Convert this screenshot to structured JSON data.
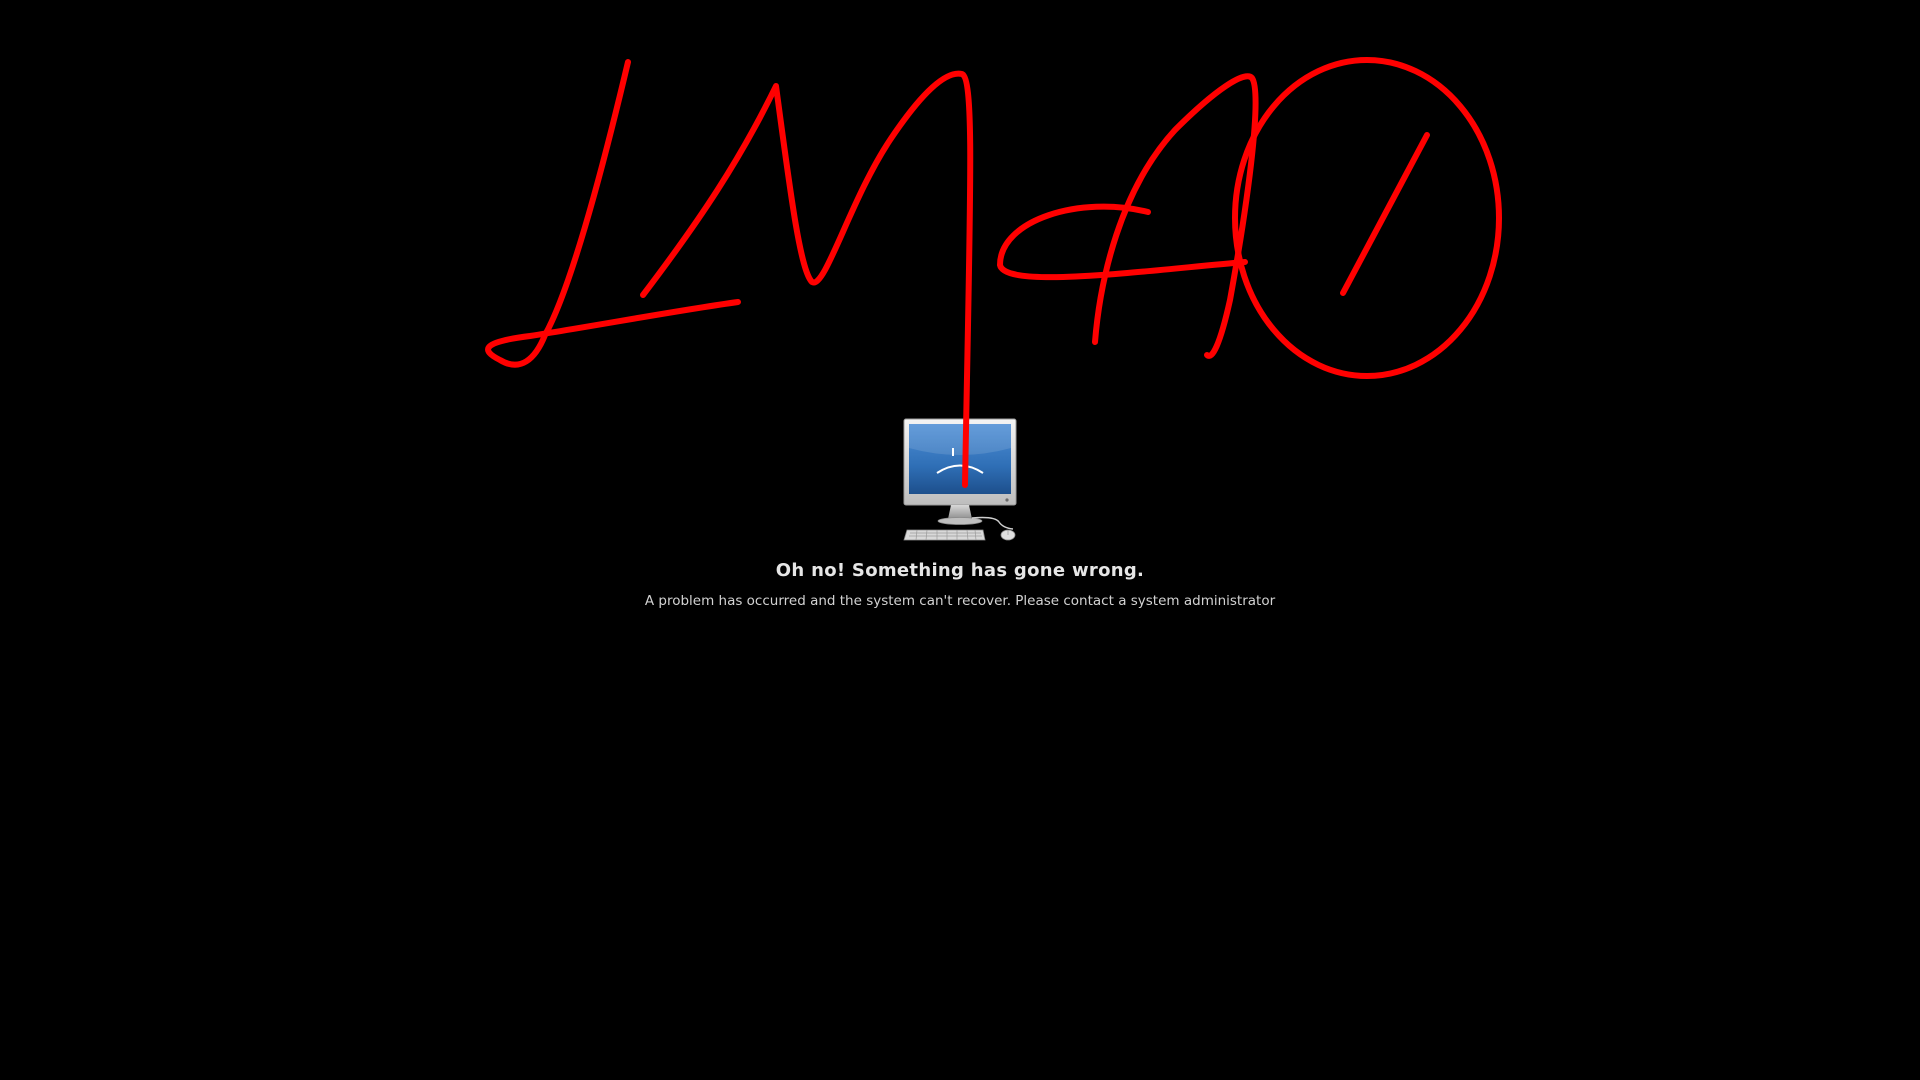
{
  "error": {
    "title": "Oh no!  Something has gone wrong.",
    "message": "A problem has occurred and the system can't recover. Please contact a system administrator",
    "icon": "sad-computer-icon"
  },
  "annotation": {
    "text": "LMAO",
    "color": "#ff0000"
  },
  "colors": {
    "background": "#000000",
    "text": "#e6e6e6",
    "monitor_screen": "#2f6fb6"
  }
}
